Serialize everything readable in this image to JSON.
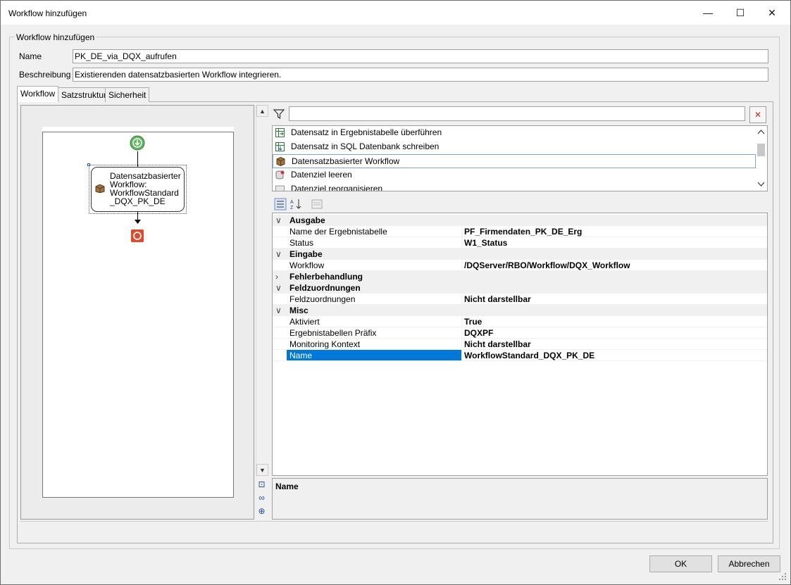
{
  "window": {
    "title": "Workflow hinzufügen",
    "minimize": "—",
    "maximize": "☐",
    "close": "✕"
  },
  "group": {
    "label": "Workflow hinzufügen"
  },
  "form": {
    "name_label": "Name",
    "name_value": "PK_DE_via_DQX_aufrufen",
    "desc_label": "Beschreibung",
    "desc_value": "Existierenden datensatzbasierten Workflow integrieren."
  },
  "tabs": [
    {
      "label": "Workflow",
      "active": true
    },
    {
      "label": "Satzstruktur",
      "active": false
    },
    {
      "label": "Sicherheit",
      "active": false
    }
  ],
  "designer": {
    "node_text": "Datensatzbasierter Workflow: WorkflowStandard _DQX_PK_DE"
  },
  "toolbox": {
    "filter_value": "",
    "items": [
      {
        "label": "Datensatz in Ergebnistabelle überführen",
        "icon": "table-transfer-icon"
      },
      {
        "label": "Datensatz in SQL Datenbank schreiben",
        "icon": "sql-write-icon"
      },
      {
        "label": "Datensatzbasierter Workflow",
        "icon": "package-icon",
        "selected": true
      },
      {
        "label": "Datenziel leeren",
        "icon": "database-clear-icon"
      },
      {
        "label": "Datenziel reorganisieren",
        "icon": "database-reorg-icon"
      }
    ]
  },
  "properties": {
    "rows": [
      {
        "type": "cat",
        "toggle": "∨",
        "name": "Ausgabe"
      },
      {
        "type": "prop",
        "name": "Name der Ergebnistabelle",
        "value": "PF_Firmendaten_PK_DE_Erg"
      },
      {
        "type": "prop",
        "name": "Status",
        "value": "W1_Status"
      },
      {
        "type": "cat",
        "toggle": "∨",
        "name": "Eingabe"
      },
      {
        "type": "prop",
        "name": "Workflow",
        "value": "/DQServer/RBO/Workflow/DQX_Workflow"
      },
      {
        "type": "cat",
        "toggle": "›",
        "name": "Fehlerbehandlung"
      },
      {
        "type": "cat",
        "toggle": "∨",
        "name": "Feldzuordnungen"
      },
      {
        "type": "prop",
        "name": "Feldzuordnungen",
        "value": "Nicht darstellbar"
      },
      {
        "type": "cat",
        "toggle": "∨",
        "name": "Misc"
      },
      {
        "type": "prop",
        "name": "Aktiviert",
        "value": "True"
      },
      {
        "type": "prop",
        "name": "Ergebnistabellen Präfix",
        "value": "DQXPF"
      },
      {
        "type": "prop",
        "name": "Monitoring Kontext",
        "value": "Nicht darstellbar"
      },
      {
        "type": "prop",
        "name": "Name",
        "value": "WorkflowStandard_DQX_PK_DE",
        "selected": true
      }
    ],
    "description_title": "Name"
  },
  "buttons": {
    "ok": "OK",
    "cancel": "Abbrechen"
  },
  "colors": {
    "selection": "#0078d7",
    "start": "#5cb85c",
    "end": "#e04a2a"
  }
}
